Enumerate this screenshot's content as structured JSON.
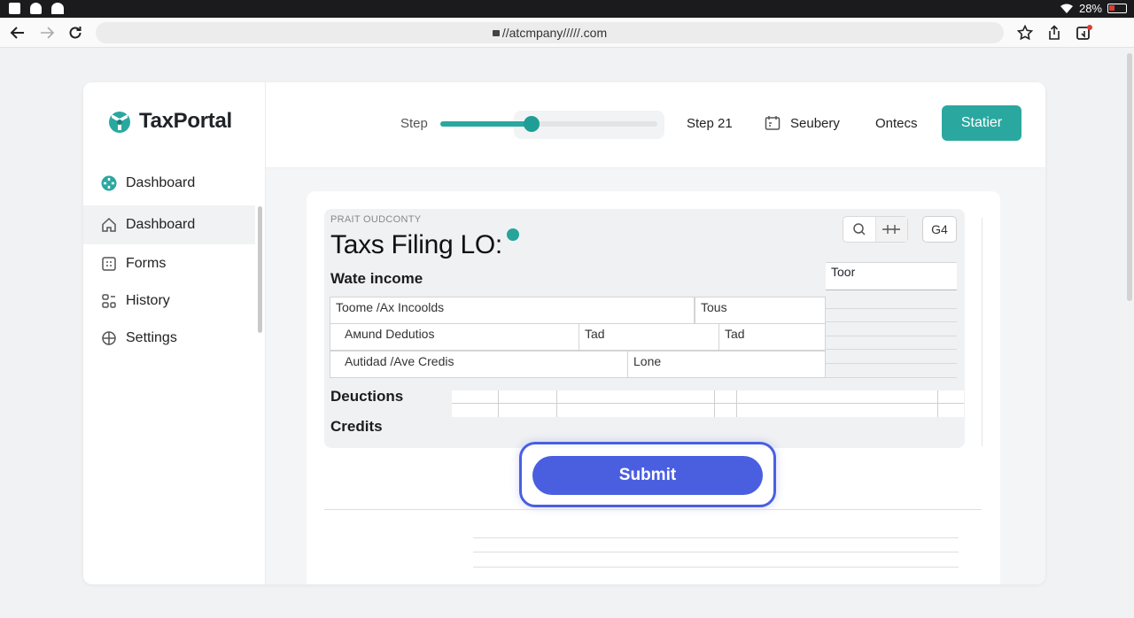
{
  "status_bar": {
    "battery": "28%"
  },
  "browser": {
    "url": "//atcmpany/////.com"
  },
  "app": {
    "brand": "TaxPortal",
    "sidebar": {
      "items": [
        {
          "label": "Dashboard",
          "icon": "dashboard-logo-icon"
        },
        {
          "label": "Dashboard",
          "icon": "home-icon",
          "active": true
        },
        {
          "label": "Forms",
          "icon": "forms-icon"
        },
        {
          "label": "History",
          "icon": "history-icon"
        },
        {
          "label": "Settings",
          "icon": "settings-icon"
        }
      ]
    },
    "header": {
      "step_label": "Step",
      "progress": 0.42,
      "step_text": "Step 21",
      "summary_label": "Seubery",
      "contacts_label": "Ontecs",
      "cta_label": "Statier"
    },
    "form": {
      "kicker": "PRAIT OUDCONTY",
      "title": "Taxs Filing LO:",
      "section_wage": "Wate income",
      "toolbar_button": "G4",
      "toor_label": "Toor",
      "rows": [
        {
          "cells": [
            "Toome /Ax Incoolds",
            "Tous"
          ]
        },
        {
          "cells": [
            "Aмund Dedutios",
            "Tad",
            "Tad"
          ]
        },
        {
          "cells": [
            "Autidad /Ave Credis",
            "Lone"
          ]
        }
      ],
      "section_deductions": "Deuctions",
      "section_credits": "Credits",
      "submit_label": "Submit"
    }
  },
  "colors": {
    "accent": "#2aa8a0",
    "submit": "#4a5fe0"
  }
}
